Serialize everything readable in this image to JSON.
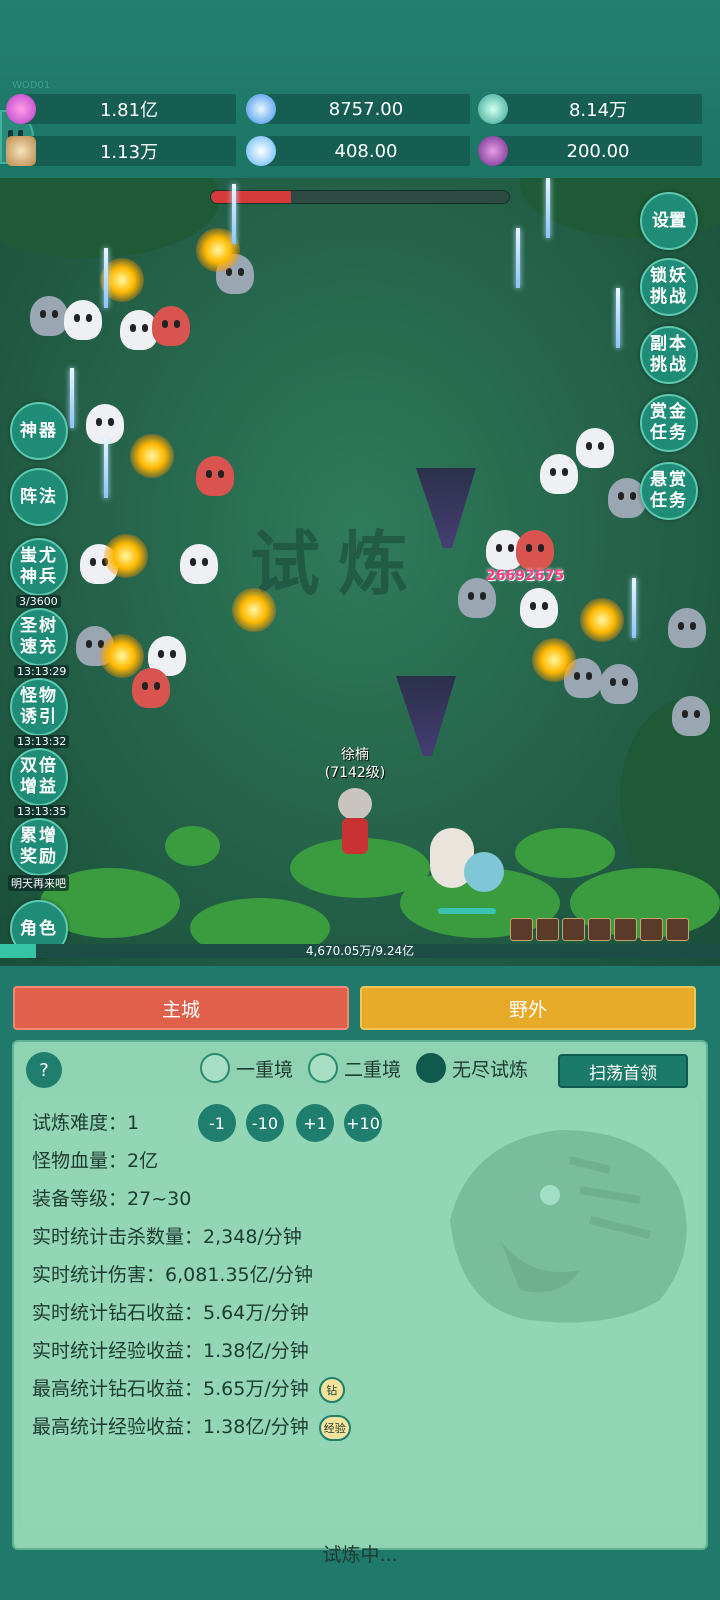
{
  "top": {
    "version": "WOD01",
    "resources": [
      {
        "icon": "diamond-icon",
        "value": "1.81亿"
      },
      {
        "icon": "blue-crystal-icon",
        "value": "8757.00"
      },
      {
        "icon": "teal-orb-icon",
        "value": "8.14万"
      },
      {
        "icon": "scroll-icon",
        "value": "1.13万"
      },
      {
        "icon": "ice-shard-icon",
        "value": "408.00"
      },
      {
        "icon": "purple-pot-icon",
        "value": "200.00"
      }
    ]
  },
  "battle": {
    "right_buttons": [
      "设置",
      "锁妖挑战",
      "副本挑战",
      "赏金任务",
      "悬赏任务"
    ],
    "left_buttons": [
      "神器",
      "阵法",
      "蚩尤神兵",
      "圣树速充",
      "怪物诱引",
      "双倍增益",
      "累增奖励",
      "角色"
    ],
    "left_sub": {
      "chiyou": "3/3600",
      "shengshu": "13:13:29",
      "guaiwu": "13:13:32",
      "shuangbei": "13:13:35",
      "leizeng": "明天再来吧"
    },
    "damage_number": "26692675",
    "hero_name": "徐楠",
    "hero_level": "(7142级)",
    "exp_text": "4,670.05万/9.24亿",
    "exp_fraction": 0.05,
    "boss_hp_fraction": 0.27
  },
  "tabs": {
    "city": "主城",
    "wild": "野外"
  },
  "panel": {
    "help": "?",
    "modes": [
      "一重境",
      "二重境",
      "无尽试炼"
    ],
    "selected_mode": "无尽试炼",
    "sweep_button": "扫荡首领",
    "difficulty_label": "试炼难度：",
    "difficulty_value": "1",
    "adjust_buttons": [
      "-1",
      "-10",
      "+1",
      "+10"
    ],
    "stats": [
      {
        "label": "怪物血量：",
        "value": "2亿"
      },
      {
        "label": "装备等级：",
        "value": "27~30"
      },
      {
        "label": "实时统计击杀数量：",
        "value": "2,348/分钟"
      },
      {
        "label": "实时统计伤害：",
        "value": "6,081.35亿/分钟"
      },
      {
        "label": "实时统计钻石收益：",
        "value": "5.64万/分钟"
      },
      {
        "label": "实时统计经验收益：",
        "value": "1.38亿/分钟"
      },
      {
        "label": "最高统计钻石收益：",
        "value": "5.65万/分钟"
      },
      {
        "label": "最高统计经验收益：",
        "value": "1.38亿/分钟"
      }
    ],
    "badge_diamond": "钻",
    "badge_exp": "经验",
    "status": "试炼中..."
  },
  "colors": {
    "accent": "#1f7e6d",
    "city_button": "#e0604b",
    "wild_button": "#e7a928",
    "panel_bg": "#8fd3b2"
  }
}
